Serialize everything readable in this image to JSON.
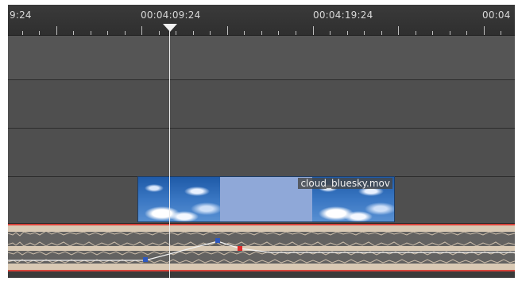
{
  "ruler": {
    "timecodes": [
      "9:24",
      "00:04:09:24",
      "00:04:19:24",
      "00:04"
    ]
  },
  "clip": {
    "name": "cloud_bluesky.mov"
  },
  "colors": {
    "ruler_bg": "#343434",
    "track_bg": "#4f4f4f",
    "clip_border": "#1d3d66",
    "clip_mid": "#8fa8d8",
    "audio_bg": "#d9c9b4",
    "audio_border": "#d8443b",
    "waveform": "#5d5d5d",
    "keyframe_blue": "#2d58bf",
    "keyframe_red": "#e02a2a",
    "playhead": "#ececec"
  }
}
